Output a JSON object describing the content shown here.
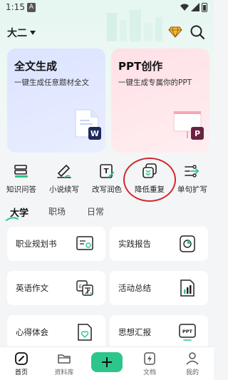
{
  "status_bar": {
    "time": "1:15",
    "alert_badge": "A"
  },
  "header": {
    "grade_label": "大二"
  },
  "feature_cards": [
    {
      "title": "全文生成",
      "subtitle": "一键生成任意题材全文",
      "badge": "W"
    },
    {
      "title": "PPT创作",
      "subtitle": "一键生成专属你的PPT",
      "badge": "P"
    }
  ],
  "tools": [
    {
      "label": "知识问答",
      "icon": "books-icon"
    },
    {
      "label": "小说续写",
      "icon": "pen-write-icon"
    },
    {
      "label": "改写润色",
      "icon": "edit-text-icon"
    },
    {
      "label": "降低重复",
      "icon": "reduce-duplicate-icon"
    },
    {
      "label": "单句扩写",
      "icon": "expand-sentence-icon"
    }
  ],
  "categories": {
    "items": [
      "大学",
      "职场",
      "日常"
    ],
    "active": "大学"
  },
  "templates": [
    {
      "label": "职业规划书",
      "icon": "certificate-icon"
    },
    {
      "label": "实践报告",
      "icon": "report-chart-icon"
    },
    {
      "label": "英语作文",
      "icon": "translate-icon"
    },
    {
      "label": "活动总结",
      "icon": "bar-chart-doc-icon"
    },
    {
      "label": "心得体会",
      "icon": "heart-doc-icon"
    },
    {
      "label": "思想汇报",
      "icon": "ppt-doc-icon"
    }
  ],
  "bottom_nav": [
    {
      "label": "首页",
      "icon": "home-icon",
      "active": true
    },
    {
      "label": "资料库",
      "icon": "folder-icon",
      "active": false
    },
    {
      "label": "",
      "icon": "plus-icon",
      "active": false
    },
    {
      "label": "文档",
      "icon": "document-bolt-icon",
      "active": false
    },
    {
      "label": "我的",
      "icon": "user-icon",
      "active": false
    }
  ],
  "colors": {
    "accent_green": "#2ec58a",
    "highlight_ring": "#d3282b",
    "card_blue": "#dbe3ff",
    "card_pink": "#ffe0e6"
  }
}
